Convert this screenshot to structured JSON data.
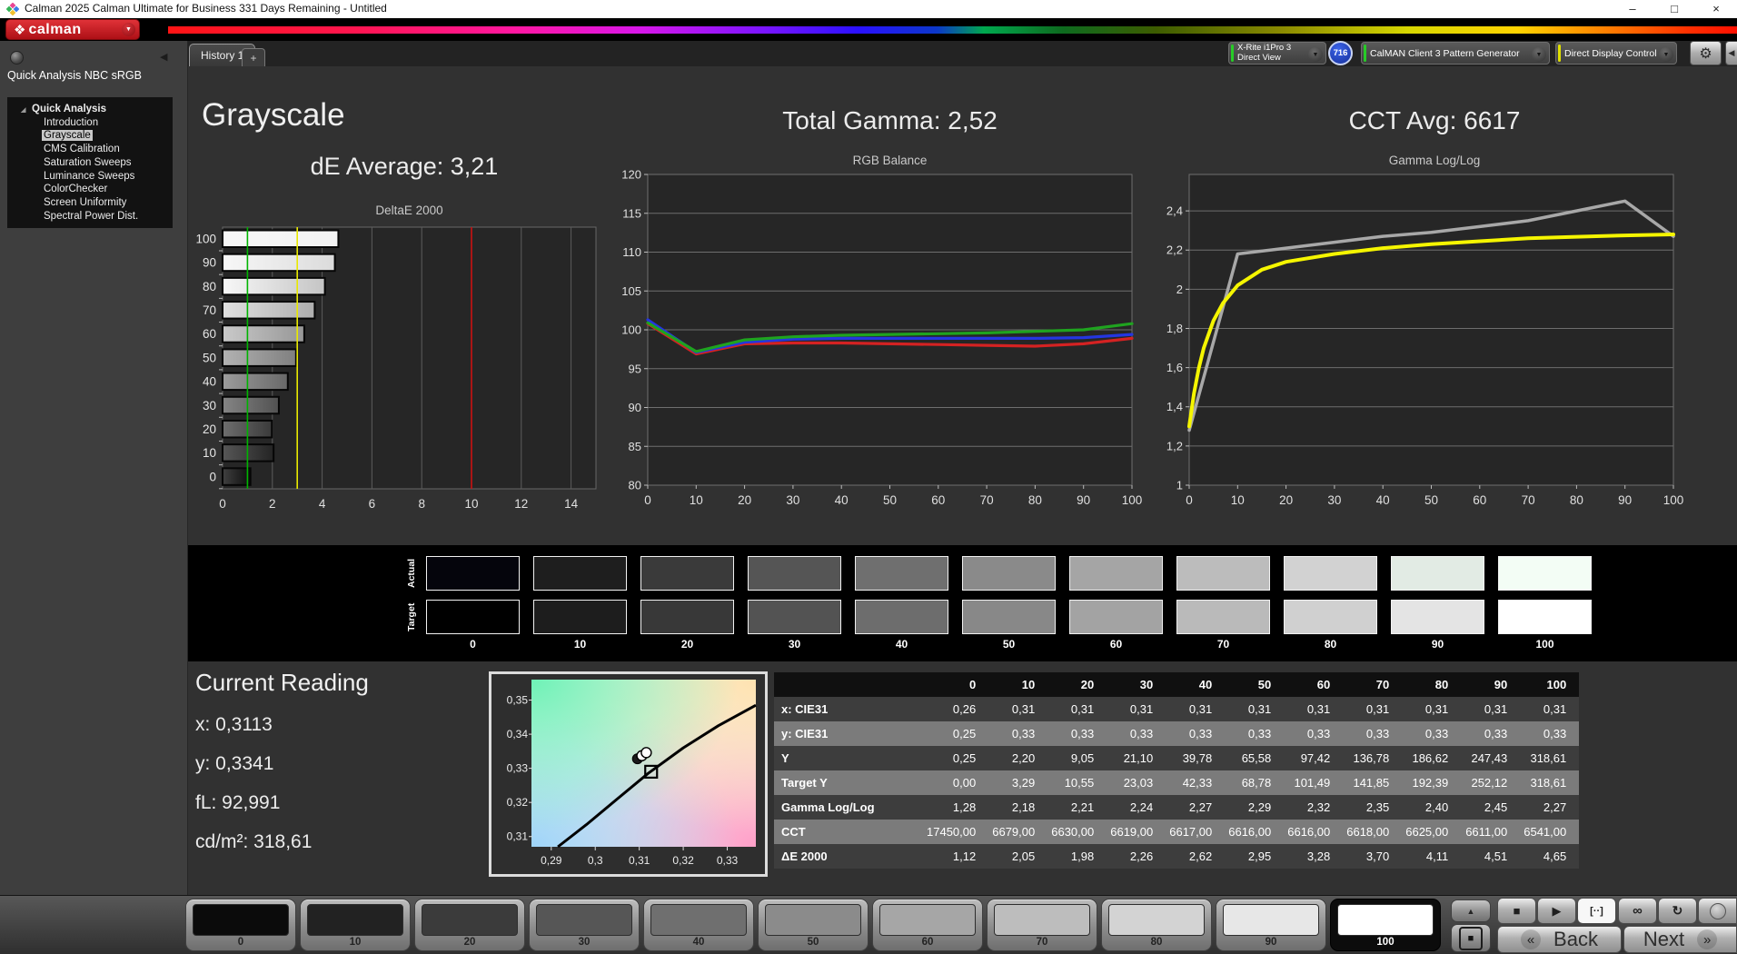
{
  "window": {
    "title": "Calman 2025 Calman Ultimate for Business 331 Days Remaining  - Untitled"
  },
  "logo": {
    "text": "calman"
  },
  "icons": {
    "minimize": "–",
    "restore": "□",
    "close": "×",
    "chevron_down": "▼",
    "logo_diamond": "❖",
    "collapse_left": "◀",
    "gear": "⚙",
    "tree_expanded": "◢",
    "stop": "■",
    "play": "▶",
    "brackets": "[··]",
    "infinity": "∞",
    "refresh": "↻",
    "up": "▲",
    "square": "■",
    "back_arrow": "«",
    "next_arrow": "»"
  },
  "toolbar": {
    "tab": "History 1",
    "tab_add": "+",
    "meter": {
      "line1": "X-Rite i1Pro 3",
      "line2": "Direct View",
      "badge": "716"
    },
    "pattern_generator": "CalMAN Client 3 Pattern Generator",
    "display_control": "Direct Display Control"
  },
  "sidebar": {
    "workflow_title": "Quick Analysis NBC sRGB",
    "root": "Quick Analysis",
    "items": [
      "Introduction",
      "Grayscale",
      "CMS Calibration",
      "Saturation Sweeps",
      "Luminance Sweeps",
      "ColorChecker",
      "Screen Uniformity",
      "Spectral Power Dist."
    ],
    "selected": "Grayscale"
  },
  "headers": {
    "page_title": "Grayscale",
    "de_average": "dE Average: 3,21",
    "total_gamma": "Total Gamma: 2,52",
    "cct_avg": "CCT Avg: 6617"
  },
  "chart_data": [
    {
      "type": "bar",
      "title": "DeltaE 2000",
      "orientation": "horizontal",
      "categories": [
        0,
        10,
        20,
        30,
        40,
        50,
        60,
        70,
        80,
        90,
        100
      ],
      "values": [
        1.12,
        2.05,
        1.98,
        2.26,
        2.62,
        2.95,
        3.28,
        3.7,
        4.11,
        4.51,
        4.65
      ],
      "xlim": [
        0,
        15
      ],
      "x_ticks": [
        0,
        2,
        4,
        6,
        8,
        10,
        12,
        14
      ],
      "bar_order": "100 at top, 0 at bottom; bar fill equals the gray stimulus level",
      "reference_lines": [
        {
          "value": 1,
          "color": "#00b400"
        },
        {
          "value": 3,
          "color": "#e8e800"
        },
        {
          "value": 10,
          "color": "#cc1111"
        }
      ]
    },
    {
      "type": "line",
      "title": "RGB Balance",
      "x": [
        0,
        10,
        20,
        30,
        40,
        50,
        60,
        70,
        80,
        90,
        100
      ],
      "ylim": [
        80,
        120
      ],
      "y_ticks": [
        80,
        85,
        90,
        95,
        100,
        105,
        110,
        115,
        120
      ],
      "series": [
        {
          "name": "Red",
          "color": "#d42222",
          "values": [
            100.8,
            96.9,
            98.2,
            98.3,
            98.3,
            98.2,
            98.1,
            98.0,
            97.9,
            98.2,
            98.9
          ]
        },
        {
          "name": "Green",
          "color": "#1fa31f",
          "values": [
            100.9,
            97.2,
            98.7,
            99.1,
            99.3,
            99.4,
            99.5,
            99.6,
            99.8,
            100.0,
            100.8
          ]
        },
        {
          "name": "Blue",
          "color": "#2436e0",
          "values": [
            101.3,
            97.1,
            98.4,
            98.8,
            98.9,
            98.9,
            98.9,
            98.9,
            98.9,
            99.0,
            99.4
          ]
        }
      ]
    },
    {
      "type": "line",
      "title": "Gamma Log/Log",
      "x": [
        0,
        10,
        20,
        30,
        40,
        50,
        60,
        70,
        80,
        90,
        100
      ],
      "ylim": [
        1,
        2.586
      ],
      "y_ticks": [
        1,
        1.2,
        1.4,
        1.6,
        1.8,
        2,
        2.2,
        2.4
      ],
      "series": [
        {
          "name": "Measured",
          "color": "#a8a8a8",
          "values": [
            1.28,
            2.18,
            2.21,
            2.24,
            2.27,
            2.29,
            2.32,
            2.35,
            2.4,
            2.45,
            2.27
          ]
        },
        {
          "name": "Target",
          "color": "#f5f500",
          "x": [
            0,
            1,
            2,
            3,
            5,
            7,
            10,
            15,
            20,
            30,
            40,
            50,
            60,
            70,
            80,
            90,
            100
          ],
          "values": [
            1.3,
            1.47,
            1.6,
            1.7,
            1.84,
            1.93,
            2.02,
            2.1,
            2.14,
            2.18,
            2.21,
            2.23,
            2.245,
            2.26,
            2.268,
            2.275,
            2.28
          ]
        }
      ]
    }
  ],
  "swatch_band": {
    "row_labels": [
      "Actual",
      "Target"
    ],
    "levels": [
      "0",
      "10",
      "20",
      "30",
      "40",
      "50",
      "60",
      "70",
      "80",
      "90",
      "100"
    ],
    "actual_colors": [
      "#05050c",
      "#1e1e1e",
      "#3a3a3a",
      "#555555",
      "#6f6f6f",
      "#8a8a8a",
      "#a5a5a5",
      "#bcbcbc",
      "#d2d2d2",
      "#e2ebe4",
      "#f3fdf5"
    ],
    "target_colors": [
      "#000000",
      "#1d1d1d",
      "#383838",
      "#535353",
      "#6d6d6d",
      "#888888",
      "#a3a3a3",
      "#bababa",
      "#d0d0d0",
      "#e4e4e4",
      "#ffffff"
    ]
  },
  "current_reading": {
    "title": "Current Reading",
    "x": "x: 0,3113",
    "y": "y: 0,3341",
    "fl": "fL: 92,991",
    "cdm2": "cd/m²: 318,61"
  },
  "cie": {
    "x_ticks": [
      0.29,
      0.3,
      0.31,
      0.32,
      0.33
    ],
    "y_ticks": [
      0.31,
      0.32,
      0.33,
      0.34,
      0.35
    ],
    "x_range": [
      0.2855,
      0.3365
    ],
    "y_range": [
      0.307,
      0.356
    ],
    "locus": [
      [
        0.2915,
        0.307
      ],
      [
        0.298,
        0.3135
      ],
      [
        0.305,
        0.321
      ],
      [
        0.312,
        0.3285
      ],
      [
        0.32,
        0.336
      ],
      [
        0.328,
        0.3425
      ],
      [
        0.3365,
        0.3485
      ]
    ],
    "markers": {
      "measured_cluster": [
        [
          0.3096,
          0.3328
        ],
        [
          0.3106,
          0.3337
        ],
        [
          0.3116,
          0.3346
        ]
      ],
      "target_square": [
        0.3127,
        0.329
      ]
    }
  },
  "table": {
    "columns": [
      "",
      "0",
      "10",
      "20",
      "30",
      "40",
      "50",
      "60",
      "70",
      "80",
      "90",
      "100"
    ],
    "rows": [
      {
        "label": "x: CIE31",
        "values": [
          "0,26",
          "0,31",
          "0,31",
          "0,31",
          "0,31",
          "0,31",
          "0,31",
          "0,31",
          "0,31",
          "0,31",
          "0,31"
        ]
      },
      {
        "label": "y: CIE31",
        "values": [
          "0,25",
          "0,33",
          "0,33",
          "0,33",
          "0,33",
          "0,33",
          "0,33",
          "0,33",
          "0,33",
          "0,33",
          "0,33"
        ]
      },
      {
        "label": "Y",
        "values": [
          "0,25",
          "2,20",
          "9,05",
          "21,10",
          "39,78",
          "65,58",
          "97,42",
          "136,78",
          "186,62",
          "247,43",
          "318,61"
        ]
      },
      {
        "label": "Target Y",
        "values": [
          "0,00",
          "3,29",
          "10,55",
          "23,03",
          "42,33",
          "68,78",
          "101,49",
          "141,85",
          "192,39",
          "252,12",
          "318,61"
        ]
      },
      {
        "label": "Gamma Log/Log",
        "values": [
          "1,28",
          "2,18",
          "2,21",
          "2,24",
          "2,27",
          "2,29",
          "2,32",
          "2,35",
          "2,40",
          "2,45",
          "2,27"
        ]
      },
      {
        "label": "CCT",
        "values": [
          "17450,00",
          "6679,00",
          "6630,00",
          "6619,00",
          "6617,00",
          "6616,00",
          "6616,00",
          "6618,00",
          "6625,00",
          "6611,00",
          "6541,00"
        ]
      },
      {
        "label": "ΔE 2000",
        "values": [
          "1,12",
          "2,05",
          "1,98",
          "2,26",
          "2,62",
          "2,95",
          "3,28",
          "3,70",
          "4,11",
          "4,51",
          "4,65"
        ]
      }
    ]
  },
  "bottom_bar": {
    "levels": [
      "0",
      "10",
      "20",
      "30",
      "40",
      "50",
      "60",
      "70",
      "80",
      "90",
      "100"
    ],
    "level_colors": [
      "#0b0b0b",
      "#222222",
      "#3b3b3b",
      "#565656",
      "#6f6f6f",
      "#8b8b8b",
      "#a6a6a6",
      "#bdbdbd",
      "#d3d3d3",
      "#e7e7e7",
      "#ffffff"
    ],
    "selected": "100",
    "back": "Back",
    "next": "Next"
  }
}
